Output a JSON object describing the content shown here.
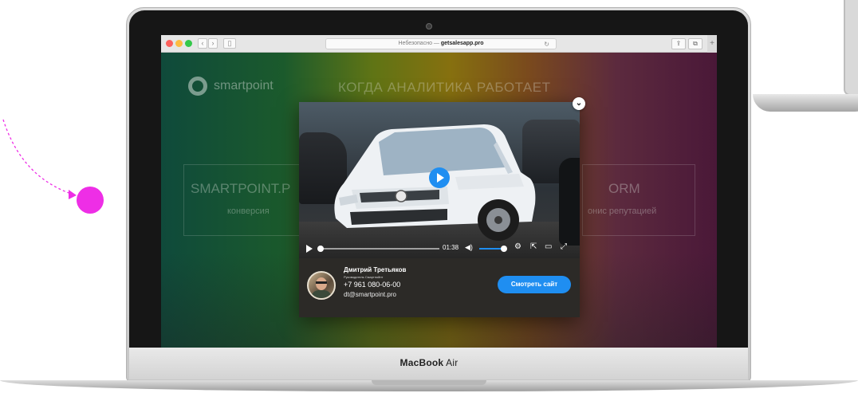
{
  "device": {
    "brand_name": "MacBook",
    "brand_model": "Air"
  },
  "browser": {
    "url_prefix": "Небезопасно —",
    "url_host": "getsalesapp.pro",
    "back_label": "‹",
    "forward_label": "›",
    "sidebar_label": "▯",
    "reload_label": "↻",
    "share_label": "⇪",
    "tabs_label": "⧉",
    "new_tab_label": "+"
  },
  "page": {
    "logo_text": "smartpoint",
    "headline": "КОГДА АНАЛИТИКА РАБОТАЕТ",
    "cards": [
      {
        "title": "SMARTPOINT.P",
        "subtitle": "конверсия"
      },
      {
        "title": "ORM",
        "subtitle": "онис репутацией"
      }
    ]
  },
  "video": {
    "close_label": "⌄",
    "time": "01:38",
    "volume_icon": "◀)",
    "progress": 0.0,
    "volume": 1.0,
    "control_icons": [
      "⚙",
      "⇱",
      "▭",
      "⤢"
    ]
  },
  "contact": {
    "name": "Дмитрий Третьяков",
    "role": "Руководитель Смартпойнт",
    "phone": "+7 961 080-06-00",
    "email": "dt@smartpoint.pro",
    "cta_label": "Смотреть сайт"
  },
  "colors": {
    "accent_blue": "#1f8ef1",
    "deco_magenta": "#ee2ee6"
  }
}
